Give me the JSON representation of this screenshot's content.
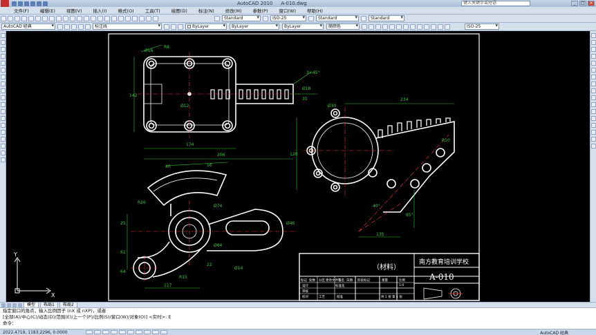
{
  "titlebar": {
    "app_name": "AutoCAD 2010",
    "document": "A-010.dwg",
    "search_placeholder": "键入关键字或短语"
  },
  "menu": [
    "文件(F)",
    "编辑(E)",
    "视图(V)",
    "插入(I)",
    "格式(O)",
    "工具(T)",
    "绘图(D)",
    "标注(N)",
    "修改(M)",
    "参数(P)",
    "窗口(W)",
    "帮助(H)"
  ],
  "toolbar1": {
    "text_style": "Standard",
    "dim_style": "ISO-25",
    "table_style": "Standard",
    "mleader_style": "Standard"
  },
  "toolbar2": {
    "workspace": "AutoCAD 经典",
    "layer": "标注线",
    "color": "ByLayer",
    "linetype": "ByLayer",
    "lineweight": "ByLayer",
    "plotstyle": "随颜色",
    "dim_style2": "ISO-25"
  },
  "drawing": {
    "title_block": {
      "material": "（材料）",
      "school": "南方教育培训学校",
      "drawing_no": "A-010"
    },
    "tb_small": [
      "标记",
      "处数",
      "分区",
      "更改文件号",
      "签名",
      "日期",
      "设计",
      "标准化",
      "阶段标记",
      "重量",
      "比例",
      "审核",
      "校对",
      "工艺",
      "批准",
      "共 1 张  第 1 张",
      "1:0"
    ],
    "dims": [
      "Ø16",
      "R8",
      "142",
      "3×45°",
      "Ø12",
      "Ø18",
      "35",
      "206",
      "174",
      "206",
      "Ø30",
      "234",
      "120",
      "R10",
      "40°",
      "135",
      "85°",
      "40",
      "56",
      "25",
      "61",
      "R26",
      "Ø74",
      "Ø46",
      "117",
      "64",
      "R15",
      "22",
      "Ø14",
      "Ø64"
    ]
  },
  "tabs": [
    "模型",
    "布局1",
    "布局2"
  ],
  "cmdline": {
    "line1": "指定窗口的角点，输入比例因子 (nX 或 nXP)，或者",
    "line2": "[全部(A)/中心(C)/动态(D)/范围(E)/上一个(P)/比例(S)/窗口(W)/对象(O)] <实时>: E",
    "line3": "命令："
  },
  "status": {
    "coords": "2022.4719, 1183.2296, 0.0000",
    "annotation": "AutoCAD 经典"
  },
  "colors": {
    "ui": "#d6dfec",
    "canvas": "#000000",
    "geometry": "#ffffff",
    "dimension": "#33cc33",
    "center": "#ff3333"
  }
}
